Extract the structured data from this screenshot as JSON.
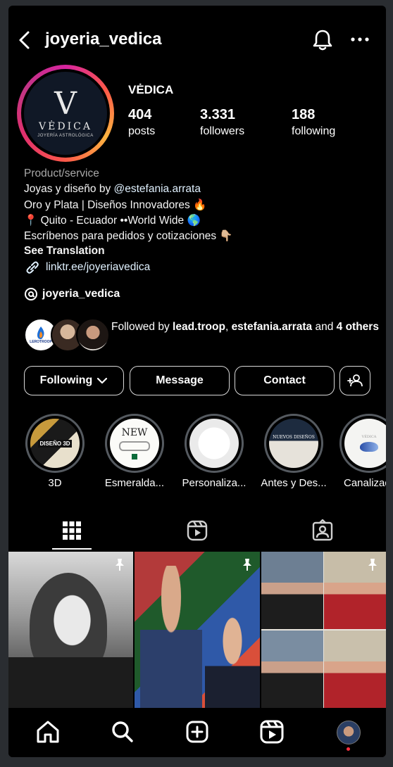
{
  "header": {
    "username": "joyeria_vedica",
    "icons": [
      "back-chevron-icon",
      "bell-icon",
      "more-icon"
    ]
  },
  "profile": {
    "display_name": "VĖDICA",
    "avatar_logo": {
      "mark": "V",
      "name": "VĖDICA",
      "tagline": "JOYERÍA ASTROLÓGICA"
    },
    "stats": {
      "posts": {
        "value": "404",
        "label": "posts"
      },
      "followers": {
        "value": "3.331",
        "label": "followers"
      },
      "following": {
        "value": "188",
        "label": "following"
      }
    }
  },
  "bio": {
    "category": "Product/service",
    "line1_prefix": "Joyas y diseño by ",
    "line1_mention": "@estefania.arrata",
    "line2": "Oro y Plata | Diseños Innovadores 🔥",
    "line3": "📍 Quito - Ecuador ••World Wide 🌎",
    "line4": "Escríbenos para pedidos y cotizaciones 👇🏼",
    "see_translation": "See Translation",
    "link": "linktr.ee/joyeriavedica",
    "threads_handle": "joyeria_vedica"
  },
  "followed_by": {
    "prefix": "Followed by ",
    "names": "lead.troop",
    "sep": ", ",
    "names2": "estefania.arrata",
    "mid": " and ",
    "others": "4 others",
    "avatar1_text": "LEROTROOP"
  },
  "actions": {
    "following": "Following",
    "message": "Message",
    "contact": "Contact"
  },
  "highlights": [
    {
      "label": "3D",
      "cover_text": "DISEÑO 3D"
    },
    {
      "label": "Esmeralda...",
      "cover_text": "NEW"
    },
    {
      "label": "Personaliza...",
      "cover_text": ""
    },
    {
      "label": "Antes y Des...",
      "cover_text": "NUEVOS DISEÑOS"
    },
    {
      "label": "Canalizad",
      "cover_text": "VĖDICA"
    }
  ],
  "tabs": [
    "grid-icon",
    "reels-icon",
    "tagged-icon"
  ],
  "nav": [
    "home-icon",
    "search-icon",
    "create-icon",
    "reels-icon",
    "profile-avatar"
  ],
  "colors": {
    "background": "#000000",
    "link": "#e0f1ff",
    "secondary_text": "#a8a8a8",
    "notification_dot": "#ff3040"
  }
}
